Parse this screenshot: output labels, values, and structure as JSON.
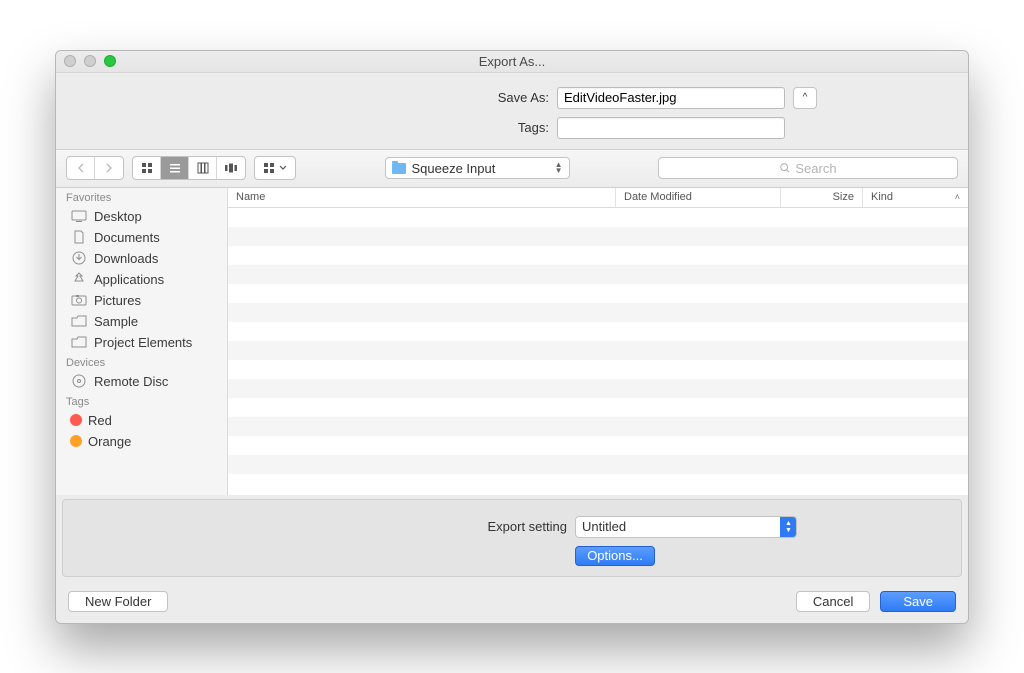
{
  "window": {
    "title": "Export As..."
  },
  "form": {
    "save_as_label": "Save As:",
    "filename": "EditVideoFaster.jpg",
    "tags_label": "Tags:",
    "tags_value": ""
  },
  "toolbar": {
    "current_folder": "Squeeze Input",
    "search_placeholder": "Search"
  },
  "sidebar": {
    "sections": {
      "favorites": {
        "label": "Favorites",
        "items": [
          {
            "label": "Desktop",
            "icon": "desktop-icon"
          },
          {
            "label": "Documents",
            "icon": "documents-icon"
          },
          {
            "label": "Downloads",
            "icon": "downloads-icon"
          },
          {
            "label": "Applications",
            "icon": "applications-icon"
          },
          {
            "label": "Pictures",
            "icon": "pictures-icon"
          },
          {
            "label": "Sample",
            "icon": "folder-icon"
          },
          {
            "label": "Project Elements",
            "icon": "folder-icon"
          }
        ]
      },
      "devices": {
        "label": "Devices",
        "items": [
          {
            "label": "Remote Disc",
            "icon": "disc-icon"
          }
        ]
      },
      "tags": {
        "label": "Tags",
        "items": [
          {
            "label": "Red",
            "color": "red"
          },
          {
            "label": "Orange",
            "color": "orange"
          }
        ]
      }
    }
  },
  "columns": {
    "name": "Name",
    "date": "Date Modified",
    "size": "Size",
    "kind": "Kind"
  },
  "export": {
    "label": "Export setting",
    "selected": "Untitled",
    "options_label": "Options..."
  },
  "buttons": {
    "new_folder": "New Folder",
    "cancel": "Cancel",
    "save": "Save"
  },
  "collapse_glyph": "^"
}
